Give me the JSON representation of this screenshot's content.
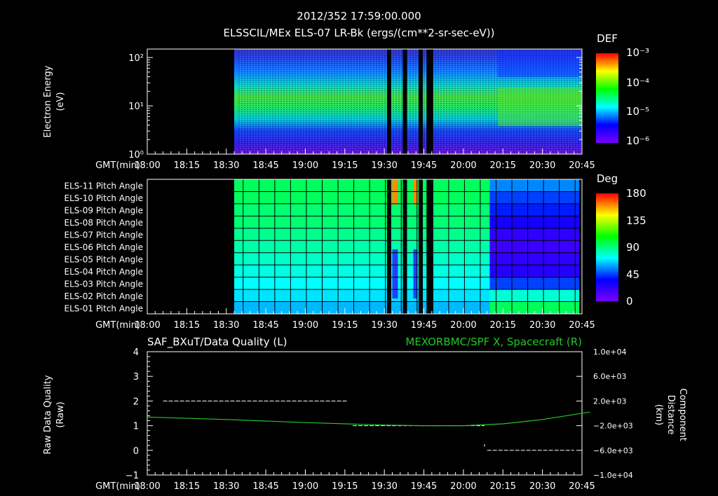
{
  "header": {
    "timestamp": "2012/352 17:59:00.000",
    "subtitle": "ELSSCIL/MEx ELS-07 LR-Bk  (ergs/(cm**2-sr-sec-eV))"
  },
  "colors": {
    "background": "#000000",
    "foreground": "#ffffff",
    "trace_green": "#22c62a",
    "data_gap": "#000000"
  },
  "chart_data": [
    {
      "type": "heatmap",
      "panel": "energy-spectrogram",
      "ylabel": [
        "Electron Energy",
        "(eV)"
      ],
      "y_scale": "log",
      "ylim": [
        1,
        150
      ],
      "y_ticks": [
        "10⁰",
        "10¹",
        "10²"
      ],
      "y_tick_values": [
        1,
        10,
        100
      ],
      "x_axis_label": "GMT(min)",
      "x_ticks": [
        "18:00",
        "18:15",
        "18:30",
        "18:45",
        "19:00",
        "19:15",
        "19:30",
        "19:45",
        "20:00",
        "20:15",
        "20:30",
        "20:45"
      ],
      "xlim": [
        "18:00",
        "20:48"
      ],
      "data_start": "18:33",
      "data_gaps": [
        [
          "19:31",
          "19:32"
        ],
        [
          "19:37",
          "19:38"
        ],
        [
          "19:43",
          "19:44"
        ],
        [
          "19:46",
          "19:48"
        ]
      ],
      "colorbar": {
        "title": "DEF",
        "scale": "log",
        "labels": [
          "10⁻³",
          "10⁻⁴",
          "10⁻⁵",
          "10⁻⁶"
        ],
        "values": [
          0.001,
          0.0001,
          1e-05,
          1e-06
        ],
        "colormap": [
          "#7a00ff",
          "#0000ff",
          "#00ffff",
          "#00ff00",
          "#ffff00",
          "#ff0000"
        ]
      }
    },
    {
      "type": "heatmap",
      "panel": "pitch-angle",
      "rows": [
        "ELS-11 Pitch Angle",
        "ELS-10 Pitch Angle",
        "ELS-09 Pitch Angle",
        "ELS-08 Pitch Angle",
        "ELS-07 Pitch Angle",
        "ELS-06 Pitch Angle",
        "ELS-05 Pitch Angle",
        "ELS-04 Pitch Angle",
        "ELS-03 Pitch Angle",
        "ELS-02 Pitch Angle",
        "ELS-01 Pitch Angle"
      ],
      "x_axis_label": "GMT(min)",
      "x_ticks": [
        "18:00",
        "18:15",
        "18:30",
        "18:45",
        "19:00",
        "19:15",
        "19:30",
        "19:45",
        "20:00",
        "20:15",
        "20:30",
        "20:45"
      ],
      "data_start": "18:33",
      "data_end": "20:44",
      "early_values_deg": [
        95,
        95,
        92,
        92,
        88,
        84,
        80,
        76,
        72,
        68,
        62
      ],
      "late_values_deg": [
        55,
        45,
        40,
        30,
        22,
        18,
        22,
        25,
        45,
        78,
        95
      ],
      "late_start": "20:10",
      "colorbar": {
        "title": "Deg",
        "labels": [
          "180",
          "135",
          "90",
          "45",
          "0"
        ],
        "values": [
          180,
          135,
          90,
          45,
          0
        ],
        "colormap": [
          "#7a00ff",
          "#0000ff",
          "#00ffff",
          "#00ff00",
          "#ffff00",
          "#ff0000"
        ]
      }
    },
    {
      "type": "line",
      "panel": "data-quality",
      "title_left": "SAF_BXuT/Data Quality (L)",
      "title_right": "MEXORBMC/SPF X, Spacecraft (R)",
      "ylabel_left": [
        "Raw Data Quality",
        "(Raw)"
      ],
      "ylabel_right": [
        "Component",
        "Distance",
        "(km)"
      ],
      "x_axis_label": "GMT(min)",
      "x_ticks": [
        "18:00",
        "18:15",
        "18:30",
        "18:45",
        "19:00",
        "19:15",
        "19:30",
        "19:45",
        "20:00",
        "20:15",
        "20:30",
        "20:45"
      ],
      "ylim_left": [
        -1,
        4
      ],
      "y_ticks_left": [
        "−1",
        "0",
        "1",
        "2",
        "3",
        "4"
      ],
      "ylim_right": [
        -10000,
        10000
      ],
      "y_ticks_right": [
        "−1.0e+04",
        "−6.0e+03",
        "−2.0e+03",
        "2.0e+03",
        "6.0e+03",
        "1.0e+04"
      ],
      "series": [
        {
          "name": "SAF_BXuT/Data Quality",
          "axis": "left",
          "segments": [
            {
              "x": [
                "18:06",
                "19:16"
              ],
              "y": 2
            },
            {
              "x": [
                "19:18",
                "20:08"
              ],
              "y": 1
            },
            {
              "x": [
                "20:09",
                "20:42"
              ],
              "y": 0
            }
          ]
        },
        {
          "name": "MEXORBMC/SPF X, Spacecraft",
          "axis": "right",
          "x": [
            "18:00",
            "18:30",
            "19:00",
            "19:30",
            "19:45",
            "20:00",
            "20:15",
            "20:30",
            "20:48"
          ],
          "y": [
            -600,
            -1000,
            -1500,
            -1900,
            -2000,
            -2000,
            -1700,
            -1000,
            200
          ]
        }
      ]
    }
  ]
}
